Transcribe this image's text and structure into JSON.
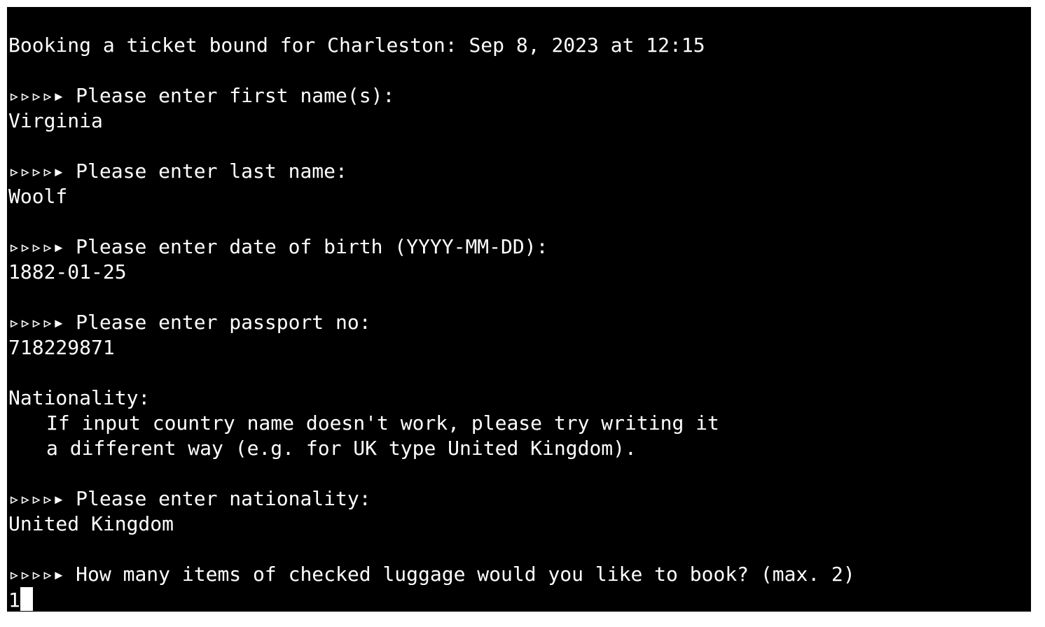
{
  "terminal": {
    "booking_header": "Booking a ticket bound for Charleston: Sep 8, 2023 at 12:15",
    "prompt_marker": "▹▹▹▹▸",
    "first_name_prompt": "Please enter first name(s):",
    "first_name_value": "Virginia",
    "last_name_prompt": "Please enter last name:",
    "last_name_value": "Woolf",
    "dob_prompt": "Please enter date of birth (YYYY-MM-DD):",
    "dob_value": "1882-01-25",
    "passport_prompt": "Please enter passport no:",
    "passport_value": "718229871",
    "nationality_heading": "Nationality:",
    "nationality_hint_line1": "If input country name doesn't work, please try writing it",
    "nationality_hint_line2": "a different way (e.g. for UK type United Kingdom).",
    "nationality_prompt": "Please enter nationality:",
    "nationality_value": "United Kingdom",
    "luggage_prompt": "How many items of checked luggage would you like to book? (max. 2)",
    "luggage_input_value": "1"
  }
}
